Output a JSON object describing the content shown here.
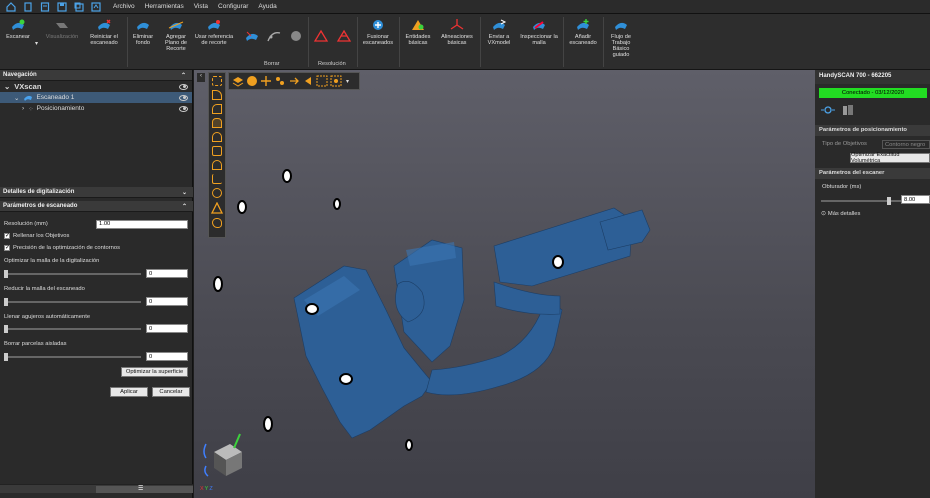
{
  "menu": {
    "items": [
      "Archivo",
      "Herramientas",
      "Vista",
      "Configurar",
      "Ayuda"
    ]
  },
  "ribbon": {
    "scan": "Escanear",
    "visualization": "Visualización",
    "reset_scan": "Reiniciar el escaneado",
    "remove_background": "Eliminar fondo",
    "add_clip_plane": "Agregar Plano de Recorte",
    "use_clip_ref": "Usar referencia de recorte",
    "group_delete": "Borrar",
    "group_resolution": "Resolución",
    "merge_scans": "Fusionar escaneados",
    "basic_entities": "Entidades básicas",
    "basic_alignments": "Alineaciones básicas",
    "send_vxmodel": "Enviar a VXmodel",
    "inspect_mesh": "Inspeccionar la malla",
    "add_scanner": "Añadir escaneado",
    "workflow": "Flujo de Trabajo Básico guiado"
  },
  "navigation": {
    "title": "Navegación",
    "root": "VXscan",
    "scan1": "Escaneado 1",
    "positioning": "Posicionamiento"
  },
  "details": {
    "title": "Detalles de digitalización"
  },
  "params": {
    "title": "Parámetros de escaneado",
    "resolution_label": "Resolución (mm)",
    "resolution_value": "1.00",
    "fill_targets": "Rellenar los Objetivos",
    "contour_precision": "Precisión de la optimización de contornos",
    "optimize_mesh": "Optimizar la malla de la digitalización",
    "optimize_mesh_value": "0",
    "reduce_mesh": "Reducir la malla del escaneado",
    "reduce_mesh_value": "0",
    "fill_holes": "Llenar agujeros automáticamente",
    "fill_holes_value": "0",
    "delete_patches": "Borrar parcelas aisladas",
    "delete_patches_value": "0",
    "optimize_surface": "Optimizar la superficie",
    "apply": "Aplicar",
    "cancel": "Cancelar"
  },
  "scanner": {
    "name": "HandySCAN 700 - 662205",
    "status": "Conectado - 03/12/2020",
    "status_color": "#22dd22",
    "pos_params": "Parámetros de posicionamiento",
    "target_type_label": "Tipo de Objetivos",
    "target_type_value": "Contorno negro",
    "optimize_volumetric": "Optimizar Exactitud Volumétrica",
    "scanner_params": "Parámetros del escaner",
    "shutter_label": "Obturador (ms)",
    "shutter_value": "8.00",
    "shutter_level": 0.85,
    "more_details": "Más detalles"
  },
  "axes": {
    "x": "X",
    "y": "Y",
    "z": "Z"
  }
}
